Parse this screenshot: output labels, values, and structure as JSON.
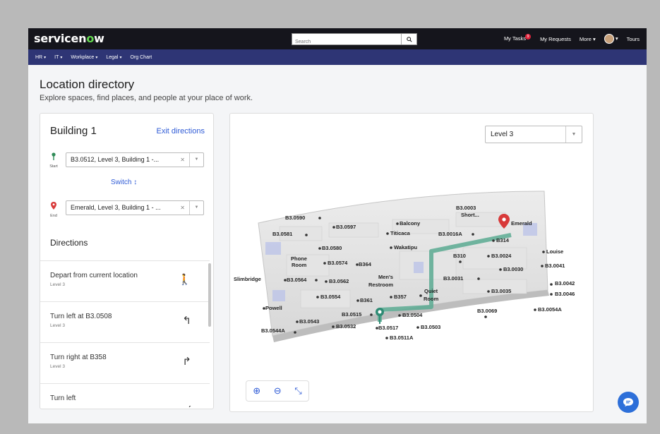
{
  "header": {
    "brand_prefix": "servicen",
    "brand_o": "o",
    "brand_suffix": "w",
    "search_placeholder": "Search",
    "my_tasks": "My Tasks",
    "my_tasks_badge": "9",
    "my_requests": "My Requests",
    "more": "More",
    "tours": "Tours"
  },
  "navbar": {
    "items": [
      "HR",
      "IT",
      "Workplace",
      "Legal",
      "Org Chart"
    ]
  },
  "page": {
    "title": "Location directory",
    "subtitle": "Explore spaces, find places, and people at your place of work."
  },
  "left": {
    "building": "Building 1",
    "exit": "Exit directions",
    "start_label": "Start",
    "start_value": "B3.0512, Level 3, Building 1 -...",
    "switch": "Switch",
    "end_label": "End",
    "end_value": "Emerald, Level 3, Building 1 - ...",
    "directions_heading": "Directions",
    "steps": [
      {
        "title": "Depart from current location",
        "sub": "Level 3"
      },
      {
        "title": "Turn left at B3.0508",
        "sub": "Level 3"
      },
      {
        "title": "Turn right at B358",
        "sub": "Level 3"
      },
      {
        "title": "Turn left",
        "sub": ""
      }
    ]
  },
  "map": {
    "level": "Level 3",
    "labels": [
      "B3.0003",
      "Short...",
      "Emerald",
      "B3.0590",
      "B3.0597",
      "Balcony",
      "B3.0581",
      "Titicaca",
      "B3.0016A",
      "B314",
      "B3.0580",
      "Wakatipu",
      "Louise",
      "Phone",
      "Room",
      "B3.0574",
      "B364",
      "B310",
      "B3.0024",
      "B3.0041",
      "B3.0030",
      "Slimbridge",
      "B3.0564",
      "B3.0562",
      "Men's",
      "Restroom",
      "B3.0031",
      "B3.0042",
      "B3.0554",
      "B361",
      "B357",
      "Quiet",
      "Room",
      "B3.0035",
      "B3.0046",
      "Powell",
      "B3.0515",
      "B3.0504",
      "B3.0069",
      "B3.0054A",
      "B3.0543",
      "B3.0532",
      "B3.0517",
      "B3.0503",
      "B3.0544A",
      "B3.0511A"
    ]
  }
}
